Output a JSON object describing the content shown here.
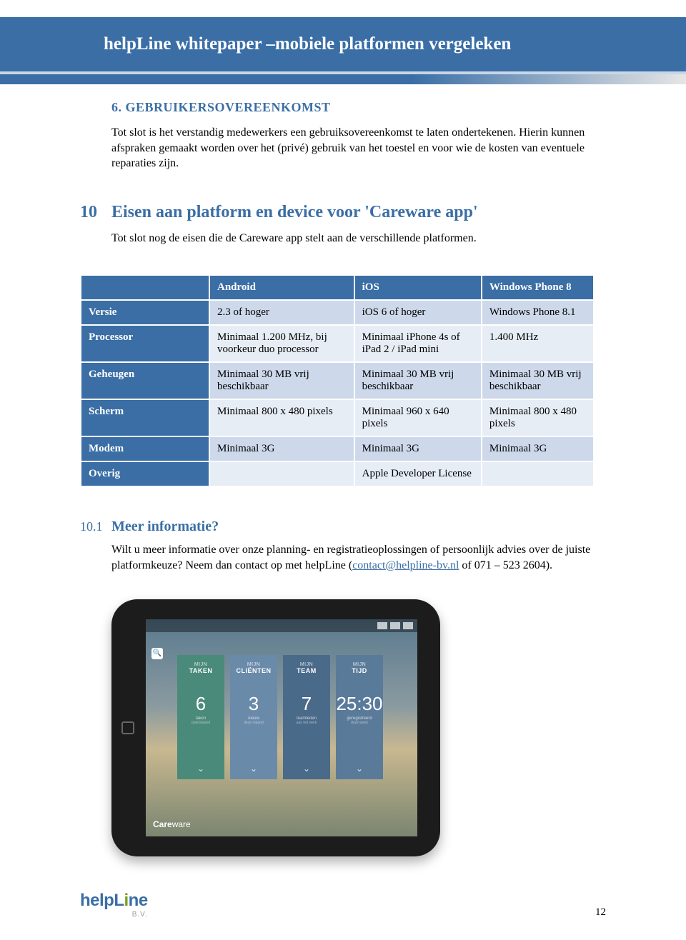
{
  "header": {
    "title": "helpLine whitepaper –mobiele platformen vergeleken"
  },
  "section6": {
    "heading": "6. GEBRUIKERSOVEREENKOMST",
    "body": "Tot slot is het verstandig medewerkers een gebruiksovereenkomst te laten ondertekenen. Hierin kunnen afspraken gemaakt worden over het (privé) gebruik van het toestel en voor wie de kosten van eventuele reparaties zijn."
  },
  "section10": {
    "num": "10",
    "title": "Eisen aan platform en device voor 'Careware app'",
    "sub": "Tot slot nog de eisen die de Careware app stelt aan de verschillende platformen."
  },
  "table": {
    "cols": [
      "",
      "Android",
      "iOS",
      "Windows Phone 8"
    ],
    "rows": [
      {
        "label": "Versie",
        "cells": [
          "2.3 of hoger",
          "iOS 6 of hoger",
          "Windows Phone 8.1"
        ]
      },
      {
        "label": "Processor",
        "cells": [
          "Minimaal 1.200 MHz, bij voorkeur duo processor",
          "Minimaal iPhone 4s of iPad 2 / iPad mini",
          "1.400 MHz"
        ]
      },
      {
        "label": "Geheugen",
        "cells": [
          "Minimaal 30 MB vrij beschikbaar",
          "Minimaal 30 MB vrij beschikbaar",
          "Minimaal 30 MB vrij beschikbaar"
        ]
      },
      {
        "label": "Scherm",
        "cells": [
          "Minimaal 800 x 480 pixels",
          "Minimaal 960 x 640 pixels",
          "Minimaal 800 x 480 pixels"
        ]
      },
      {
        "label": "Modem",
        "cells": [
          "Minimaal 3G",
          "Minimaal 3G",
          "Minimaal 3G"
        ]
      },
      {
        "label": "Overig",
        "cells": [
          "",
          "Apple Developer License",
          ""
        ]
      }
    ]
  },
  "section101": {
    "num": "10.1",
    "title": "Meer informatie?",
    "body_pre": "Wilt u meer informatie over onze planning- en registratieoplossingen of persoonlijk advies over de juiste platformkeuze? Neem dan contact op met helpLine (",
    "link_text": "contact@helpline-bv.nl",
    "body_post": " of 071 – 523 2604)."
  },
  "ipad": {
    "tiles": [
      {
        "top": "MIJN",
        "label": "TAKEN",
        "num": "6",
        "sub": "taken",
        "sub2": "openstaand"
      },
      {
        "top": "MIJN",
        "label": "CLIËNTEN",
        "num": "3",
        "sub": "nieuw",
        "sub2": "deze maand"
      },
      {
        "top": "MIJN",
        "label": "TEAM",
        "num": "7",
        "sub": "teamleden",
        "sub2": "aan het werk"
      },
      {
        "top": "MIJN",
        "label": "TIJD",
        "num": "25:30",
        "sub": "geregistreerd",
        "sub2": "deze week"
      }
    ],
    "brand_bold": "Care",
    "brand_light": "ware"
  },
  "footer": {
    "logo_main": "helpL",
    "logo_i": "i",
    "logo_rest": "ne",
    "logo_bv": "B.V.",
    "page": "12"
  }
}
